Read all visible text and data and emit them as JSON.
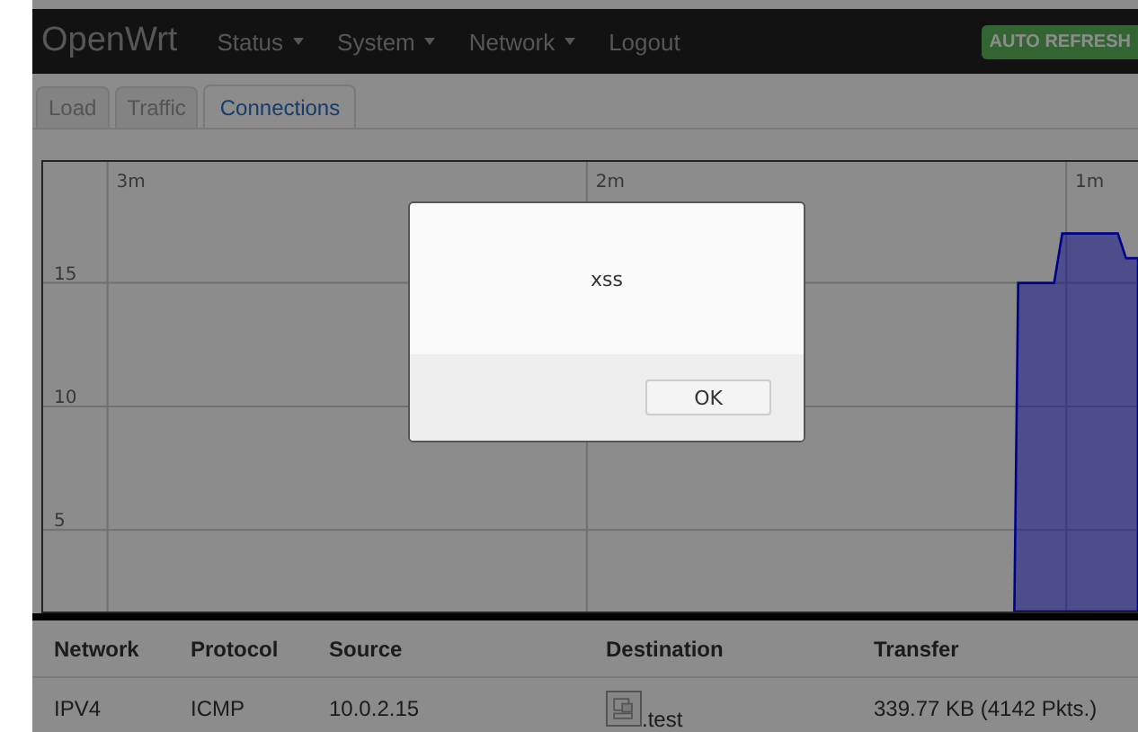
{
  "header": {
    "brand": "OpenWrt",
    "menu": [
      {
        "label": "Status",
        "dropdown": true
      },
      {
        "label": "System",
        "dropdown": true
      },
      {
        "label": "Network",
        "dropdown": true
      },
      {
        "label": "Logout",
        "dropdown": false
      }
    ],
    "badge": "AUTO REFRESH"
  },
  "tabs": [
    {
      "label": "Load",
      "selected": false
    },
    {
      "label": "Traffic",
      "selected": false
    },
    {
      "label": "Connections",
      "selected": true
    }
  ],
  "chart": {
    "chart_data": {
      "type": "area",
      "x": [
        1.157,
        1.149,
        1.074,
        1.057,
        0.941,
        0.924,
        0.899
      ],
      "series": [
        {
          "color": "#0000ff",
          "values": [
            1.7,
            15,
            15,
            17,
            17,
            16,
            16
          ]
        }
      ],
      "xlim": [
        3.183,
        0.899
      ],
      "ylim": [
        1.7,
        19.9
      ],
      "grid": true,
      "xticks": [
        {
          "value": 3,
          "label": "3m"
        },
        {
          "value": 2,
          "label": "2m"
        },
        {
          "value": 1,
          "label": "1m"
        }
      ],
      "yticks": [
        5,
        10,
        15
      ]
    }
  },
  "table": {
    "columns": [
      "Network",
      "Protocol",
      "Source",
      "Destination",
      "Transfer"
    ],
    "rows": [
      [
        "IPV4",
        "ICMP",
        "10.0.2.15",
        ".test",
        "339.77 KB (4142 Pkts.)"
      ]
    ]
  },
  "dialog": {
    "message": "xss",
    "button": "OK"
  }
}
